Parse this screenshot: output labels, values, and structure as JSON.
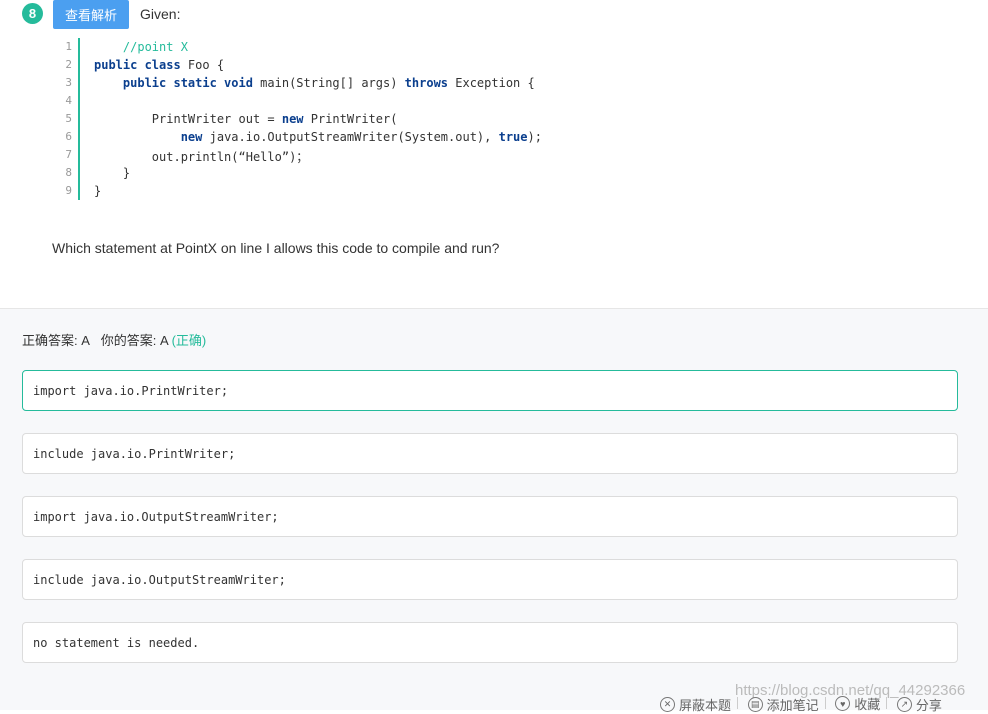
{
  "question": {
    "number": "8",
    "view_button": "查看解析",
    "intro": "Given:",
    "code_lines": [
      {
        "n": "1",
        "parts": [
          {
            "t": "    ",
            "c": ""
          },
          {
            "t": "//point X",
            "c": "cm"
          }
        ]
      },
      {
        "n": "2",
        "parts": [
          {
            "t": "public class",
            "c": "kw"
          },
          {
            "t": " Foo {",
            "c": ""
          }
        ]
      },
      {
        "n": "3",
        "parts": [
          {
            "t": "    ",
            "c": ""
          },
          {
            "t": "public static void",
            "c": "kw"
          },
          {
            "t": " main(String[] args) ",
            "c": ""
          },
          {
            "t": "throws",
            "c": "kw"
          },
          {
            "t": " Exception {",
            "c": ""
          }
        ]
      },
      {
        "n": "4",
        "parts": [
          {
            "t": "",
            "c": ""
          }
        ]
      },
      {
        "n": "5",
        "parts": [
          {
            "t": "        PrintWriter out = ",
            "c": ""
          },
          {
            "t": "new",
            "c": "kw"
          },
          {
            "t": " PrintWriter(",
            "c": ""
          }
        ]
      },
      {
        "n": "6",
        "parts": [
          {
            "t": "            ",
            "c": ""
          },
          {
            "t": "new",
            "c": "kw"
          },
          {
            "t": " java.io.OutputStreamWriter(System.out), ",
            "c": ""
          },
          {
            "t": "true",
            "c": "kw"
          },
          {
            "t": ");",
            "c": ""
          }
        ]
      },
      {
        "n": "7",
        "parts": [
          {
            "t": "        out.println(“Hello”)；",
            "c": ""
          }
        ]
      },
      {
        "n": "8",
        "parts": [
          {
            "t": "    }",
            "c": ""
          }
        ]
      },
      {
        "n": "9",
        "parts": [
          {
            "t": "}",
            "c": ""
          }
        ]
      }
    ],
    "prompt": "Which statement at PointX on line I allows this code to compile and run?"
  },
  "answer": {
    "correct_label": "正确答案: A",
    "yours_label": "你的答案: A",
    "status": "(正确)"
  },
  "options": [
    {
      "text": "import java.io.PrintWriter;",
      "selected": true
    },
    {
      "text": "include java.io.PrintWriter;",
      "selected": false
    },
    {
      "text": "import java.io.OutputStreamWriter;",
      "selected": false
    },
    {
      "text": "include java.io.OutputStreamWriter;",
      "selected": false
    },
    {
      "text": "no statement is needed.",
      "selected": false
    }
  ],
  "actions": {
    "block": "屏蔽本题",
    "note": "添加笔记",
    "fav": "收藏",
    "share": "分享"
  },
  "watermark": "https://blog.csdn.net/qq_44292366",
  "colors": {
    "accent": "#25bb9b",
    "button": "#4b9ff0"
  }
}
